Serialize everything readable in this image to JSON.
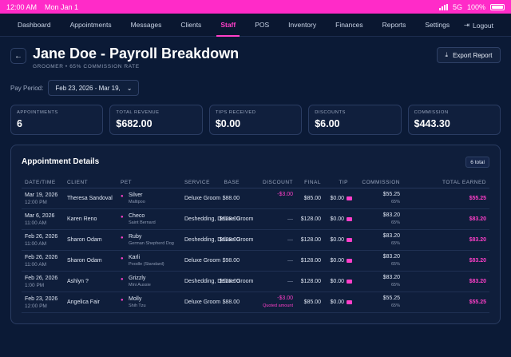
{
  "status": {
    "time": "12:00 AM",
    "date": "Mon Jan 1",
    "network": "5G",
    "battery": "100%"
  },
  "nav": {
    "items": [
      "Dashboard",
      "Appointments",
      "Messages",
      "Clients",
      "Staff",
      "POS",
      "Inventory",
      "Finances",
      "Reports",
      "Settings"
    ],
    "active": "Staff",
    "logout": "Logout"
  },
  "header": {
    "title": "Jane Doe - Payroll Breakdown",
    "subtitle": "GROOMER • 65% COMMISSION RATE",
    "export": "Export Report"
  },
  "period": {
    "label": "Pay Period:",
    "value": "Feb 23, 2026 - Mar 19,"
  },
  "stats": [
    {
      "label": "APPOINTMENTS",
      "value": "6"
    },
    {
      "label": "TOTAL REVENUE",
      "value": "$682.00"
    },
    {
      "label": "TIPS RECEIVED",
      "value": "$0.00"
    },
    {
      "label": "DISCOUNTS",
      "value": "$6.00"
    },
    {
      "label": "COMMISSION",
      "value": "$443.30"
    }
  ],
  "table": {
    "title": "Appointment Details",
    "badge": "6 total",
    "headers": [
      "DATE/TIME",
      "CLIENT",
      "PET",
      "SERVICE",
      "BASE",
      "DISCOUNT",
      "FINAL",
      "TIP",
      "COMMISSION",
      "TOTAL EARNED"
    ],
    "rows": [
      {
        "date": "Mar 19, 2026",
        "time": "12:00 PM",
        "client": "Theresa Sandoval",
        "pet": "Silver",
        "breed": "Maltipoo",
        "service": "Deluxe Groom",
        "base": "$88.00",
        "discount": "-$3.00",
        "discount_note": "",
        "final": "$85.00",
        "tip": "$0.00",
        "commission": "$55.25",
        "rate": "65%",
        "total": "$55.25"
      },
      {
        "date": "Mar 6, 2026",
        "time": "11:00 AM",
        "client": "Karen Reno",
        "pet": "Checo",
        "breed": "Saint Bernard",
        "service": "Deshedding, Deluxe Groom",
        "base": "$128.00",
        "discount": "—",
        "discount_note": "",
        "final": "$128.00",
        "tip": "$0.00",
        "commission": "$83.20",
        "rate": "65%",
        "total": "$83.20"
      },
      {
        "date": "Feb 26, 2026",
        "time": "11:00 AM",
        "client": "Sharon Odam",
        "pet": "Ruby",
        "breed": "German Shepherd Dog",
        "service": "Deshedding, Deluxe Groom",
        "base": "$128.00",
        "discount": "—",
        "discount_note": "",
        "final": "$128.00",
        "tip": "$0.00",
        "commission": "$83.20",
        "rate": "65%",
        "total": "$83.20"
      },
      {
        "date": "Feb 26, 2026",
        "time": "11:00 AM",
        "client": "Sharon Odam",
        "pet": "Karli",
        "breed": "Poodle (Standard)",
        "service": "Deluxe Groom",
        "base": "$98.00",
        "discount": "—",
        "discount_note": "",
        "final": "$128.00",
        "tip": "$0.00",
        "commission": "$83.20",
        "rate": "65%",
        "total": "$83.20"
      },
      {
        "date": "Feb 26, 2026",
        "time": "1:00 PM",
        "client": "Ashlyn ?",
        "pet": "Grizzly",
        "breed": "Mini Aussie",
        "service": "Deshedding, Deluxe Groom",
        "base": "$128.00",
        "discount": "—",
        "discount_note": "",
        "final": "$128.00",
        "tip": "$0.00",
        "commission": "$83.20",
        "rate": "65%",
        "total": "$83.20"
      },
      {
        "date": "Feb 23, 2026",
        "time": "12:00 PM",
        "client": "Angelica Fair",
        "pet": "Molly",
        "breed": "Shih Tzu",
        "service": "Deluxe Groom",
        "base": "$88.00",
        "discount": "-$3.00",
        "discount_note": "Quoted amount",
        "final": "$85.00",
        "tip": "$0.00",
        "commission": "$55.25",
        "rate": "65%",
        "total": "$55.25"
      }
    ]
  },
  "colors": {
    "accent": "#ff3fc9",
    "background": "#0b1a36",
    "status_bar": "#ff2bc8"
  }
}
